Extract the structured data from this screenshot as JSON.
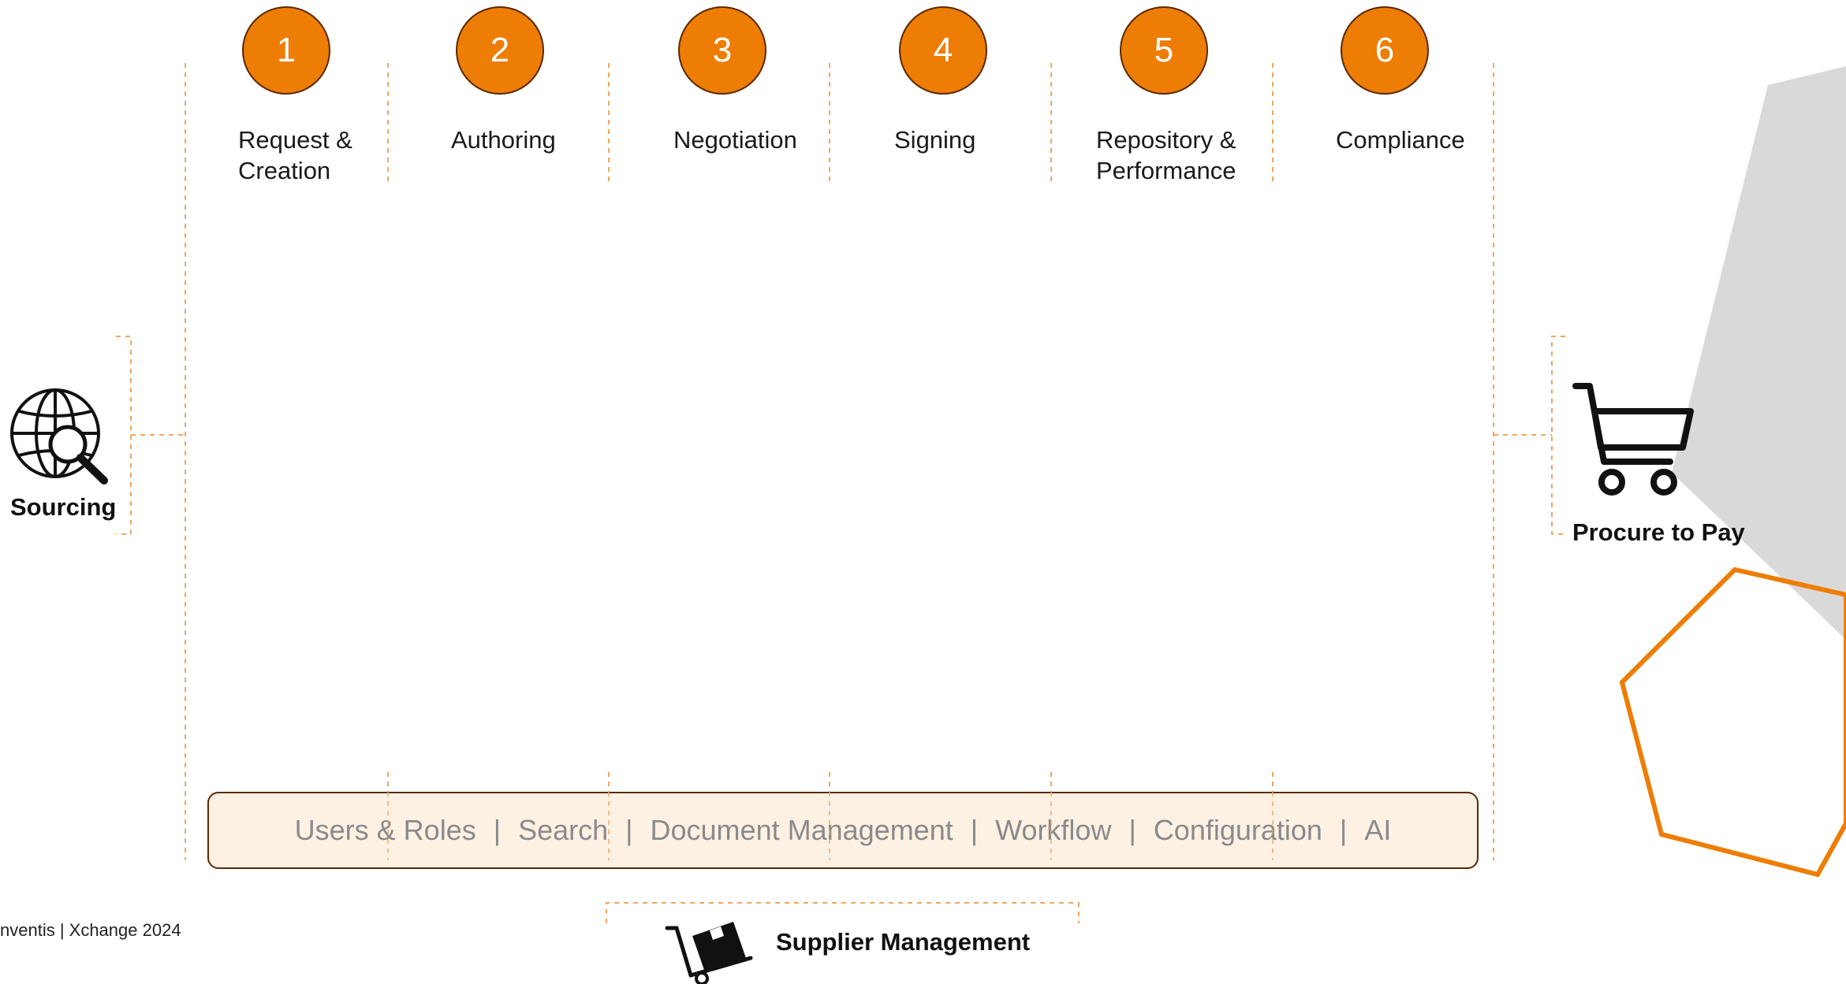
{
  "colors": {
    "accent": "#ee7d05",
    "outline": "#5a2a00",
    "platform_bg": "#fdf1e4",
    "platform_text": "#8a8a8a",
    "hexagon_gray": "#d9d9d9"
  },
  "stages": [
    {
      "number": "1",
      "label_lines": [
        "Request &",
        "Creation"
      ]
    },
    {
      "number": "2",
      "label_lines": [
        "Authoring"
      ]
    },
    {
      "number": "3",
      "label_lines": [
        "Negotiation"
      ]
    },
    {
      "number": "4",
      "label_lines": [
        "Signing"
      ]
    },
    {
      "number": "5",
      "label_lines": [
        "Repository &",
        "Performance"
      ]
    },
    {
      "number": "6",
      "label_lines": [
        "Compliance"
      ]
    }
  ],
  "left_process": {
    "label": "Sourcing",
    "icon": "globe-search-icon"
  },
  "right_process": {
    "label": "Procure to Pay",
    "icon": "shopping-cart-icon"
  },
  "bottom_process": {
    "label": "Supplier Management",
    "icon": "hand-truck-box-icon"
  },
  "platform": {
    "items": [
      "Users & Roles",
      "Search",
      "Document Management",
      "Workflow",
      "Configuration",
      "AI"
    ],
    "separator": "|"
  },
  "footer": {
    "text": "nventis | Xchange 2024"
  }
}
